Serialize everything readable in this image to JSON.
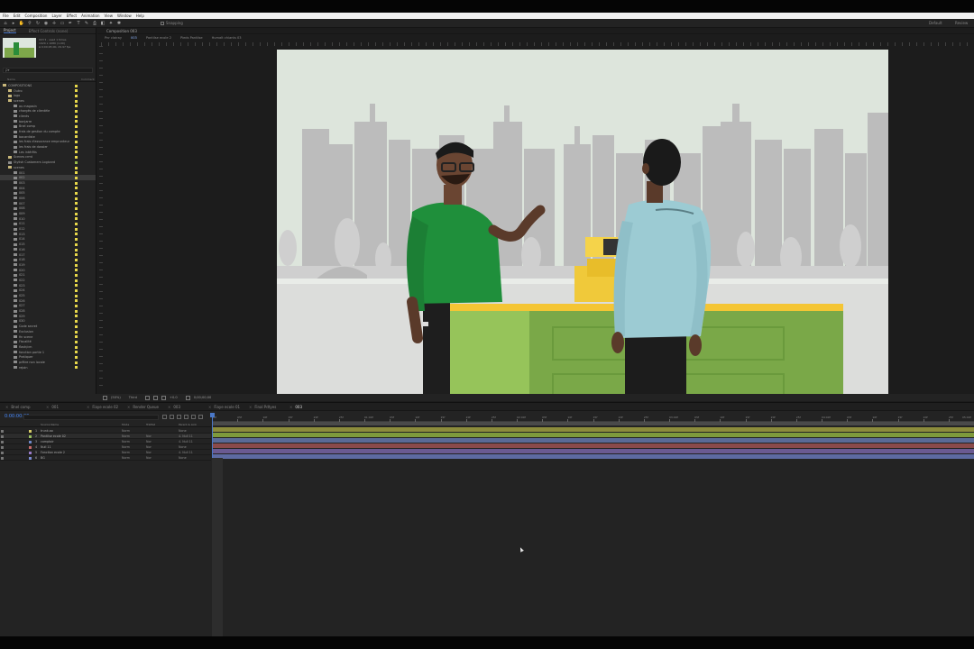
{
  "menu": [
    "File",
    "Edit",
    "Composition",
    "Layer",
    "Effect",
    "Animation",
    "View",
    "Window",
    "Help"
  ],
  "toolbar": {
    "snapping_label": "Snapping",
    "workspace_default": "Default",
    "workspace_review": "Review"
  },
  "project_panel": {
    "tabs": [
      "Project",
      "Effect Controls (none)"
    ],
    "info": [
      "003 ▾ , used 1 times",
      "1920 x 1080 (1.00)",
      "Δ 0;00;05;00, 29.97 fps"
    ],
    "search_placeholder": "ρ▾",
    "columns": {
      "name": "Name",
      "type": "Comment"
    },
    "items": [
      {
        "label": "COMPOSITIONS",
        "indent": 0,
        "folder": true,
        "tag": "y"
      },
      {
        "label": "Outro",
        "indent": 1,
        "folder": true,
        "tag": "y"
      },
      {
        "label": "logo",
        "indent": 1,
        "folder": true,
        "tag": "y"
      },
      {
        "label": "scenes",
        "indent": 1,
        "folder": true,
        "tag": "y"
      },
      {
        "label": "au magasin",
        "indent": 2,
        "tag": "y"
      },
      {
        "label": "chargés de clientèle",
        "indent": 2,
        "tag": "y"
      },
      {
        "label": "clients",
        "indent": 2,
        "tag": "y"
      },
      {
        "label": "bonjarre",
        "indent": 2,
        "tag": "y"
      },
      {
        "label": "Bnel comp",
        "indent": 2,
        "tag": "y"
      },
      {
        "label": "frais de gestion du compte",
        "indent": 2,
        "tag": "y"
      },
      {
        "label": "bacardiste",
        "indent": 2,
        "tag": "y"
      },
      {
        "label": "les frais d'assurance emprunteur",
        "indent": 2,
        "tag": "y"
      },
      {
        "label": "les frais de dossier",
        "indent": 2,
        "tag": "y"
      },
      {
        "label": "Les intérêts",
        "indent": 2,
        "tag": "y"
      },
      {
        "label": "Scenes crmt",
        "indent": 1,
        "folder": true,
        "tag": "y"
      },
      {
        "label": "Stylish Customers Logicard",
        "indent": 1,
        "tag": "g"
      },
      {
        "label": "scenes",
        "indent": 1,
        "folder": true,
        "tag": "y"
      },
      {
        "label": "001",
        "indent": 2,
        "tag": "y"
      },
      {
        "label": "002",
        "indent": 2,
        "tag": "y",
        "sel": true
      },
      {
        "label": "003",
        "indent": 2,
        "tag": "y"
      },
      {
        "label": "004",
        "indent": 2,
        "tag": "y"
      },
      {
        "label": "005",
        "indent": 2,
        "tag": "y"
      },
      {
        "label": "006",
        "indent": 2,
        "tag": "y"
      },
      {
        "label": "007",
        "indent": 2,
        "tag": "y"
      },
      {
        "label": "008",
        "indent": 2,
        "tag": "y"
      },
      {
        "label": "009",
        "indent": 2,
        "tag": "y"
      },
      {
        "label": "010",
        "indent": 2,
        "tag": "y"
      },
      {
        "label": "011",
        "indent": 2,
        "tag": "y"
      },
      {
        "label": "012",
        "indent": 2,
        "tag": "y"
      },
      {
        "label": "013",
        "indent": 2,
        "tag": "y"
      },
      {
        "label": "014",
        "indent": 2,
        "tag": "y"
      },
      {
        "label": "015",
        "indent": 2,
        "tag": "y"
      },
      {
        "label": "016",
        "indent": 2,
        "tag": "y"
      },
      {
        "label": "017",
        "indent": 2,
        "tag": "y"
      },
      {
        "label": "018",
        "indent": 2,
        "tag": "y"
      },
      {
        "label": "019",
        "indent": 2,
        "tag": "y"
      },
      {
        "label": "020",
        "indent": 2,
        "tag": "y"
      },
      {
        "label": "021",
        "indent": 2,
        "tag": "y"
      },
      {
        "label": "022",
        "indent": 2,
        "tag": "y"
      },
      {
        "label": "023",
        "indent": 2,
        "tag": "y"
      },
      {
        "label": "024",
        "indent": 2,
        "tag": "y"
      },
      {
        "label": "025",
        "indent": 2,
        "tag": "y"
      },
      {
        "label": "026",
        "indent": 2,
        "tag": "y"
      },
      {
        "label": "027",
        "indent": 2,
        "tag": "y"
      },
      {
        "label": "028",
        "indent": 2,
        "tag": "y"
      },
      {
        "label": "029",
        "indent": 2,
        "tag": "y"
      },
      {
        "label": "030",
        "indent": 2,
        "tag": "y"
      },
      {
        "label": "Code secret",
        "indent": 2,
        "tag": "y"
      },
      {
        "label": "Exclusion",
        "indent": 2,
        "tag": "y"
      },
      {
        "label": "fin scene",
        "indent": 2,
        "tag": "y"
      },
      {
        "label": "Fiscalité",
        "indent": 2,
        "tag": "y"
      },
      {
        "label": "flash/cm",
        "indent": 2,
        "tag": "y"
      },
      {
        "label": "fonction partie 1",
        "indent": 2,
        "tag": "y"
      },
      {
        "label": "Pratiquer",
        "indent": 2,
        "tag": "y"
      },
      {
        "label": "prêtre non locale",
        "indent": 2,
        "tag": "y"
      },
      {
        "label": "rejoin",
        "indent": 2,
        "tag": "y"
      }
    ],
    "footer": "8 bpc"
  },
  "composition": {
    "tab_label": "Composition 003",
    "breadcrumb": [
      "Pnr clairay",
      "003",
      "Pantilse ecole 2",
      "Pieds Pantilse",
      "Humalt chiants 03"
    ],
    "footer": [
      "(50%)",
      "Third",
      "+0.0",
      "0;00;00;00"
    ]
  },
  "timeline": {
    "tabs": [
      "Bnel comp",
      "001",
      "Fiaye ecole 02",
      "Render Queue",
      "003",
      "Fiaye ecole 01",
      "Final Pdtyes",
      "003"
    ],
    "active_tab_index": 7,
    "timecode": "0:00:00:00",
    "columns": {
      "source": "Source Name",
      "mode": "Mode",
      "trkmat": "TrkMat",
      "parent": "Parent & Link"
    },
    "layers": [
      {
        "num": "1",
        "name": "trunk.ao",
        "mode": "Norm",
        "trk": "",
        "parent": "None",
        "color": "#d8cc68"
      },
      {
        "num": "2",
        "name": "Pantilse ecole 02",
        "mode": "Norm",
        "trk": "Nor",
        "parent": "4. Null 11",
        "color": "#9ac060"
      },
      {
        "num": "3",
        "name": "comptoir",
        "mode": "Norm",
        "trk": "Nor",
        "parent": "4. Null 11",
        "color": "#6e88c8"
      },
      {
        "num": "4",
        "name": "Null 11",
        "mode": "Norm",
        "trk": "Nor",
        "parent": "None",
        "color": "#c66a6a"
      },
      {
        "num": "5",
        "name": "Fonction ecole 2",
        "mode": "Norm",
        "trk": "Nor",
        "parent": "4. Null 11",
        "color": "#9a7ac8"
      },
      {
        "num": "6",
        "name": "BG",
        "mode": "Norm",
        "trk": "Nor",
        "parent": "None",
        "color": "#7a8ad0"
      }
    ],
    "ruler_labels": [
      "00f",
      "05f",
      "10f",
      "15f",
      "20f",
      "25f",
      "01:00f",
      "05f",
      "10f",
      "15f",
      "20f",
      "25f",
      "02:00f",
      "05f",
      "10f",
      "15f",
      "20f",
      "25f",
      "03:00f",
      "05f",
      "10f",
      "15f",
      "20f",
      "25f",
      "04:00f",
      "05f",
      "10f",
      "15f",
      "20f",
      "25f",
      "05:00f"
    ],
    "track_colors": [
      "#8c8c3c",
      "#7e9a3c",
      "#5a6a96",
      "#8a4a4a",
      "#6a5a92",
      "#5d6aa2"
    ]
  },
  "colors": {
    "accent": "#4a78c8",
    "timecode": "#4a8cff"
  }
}
